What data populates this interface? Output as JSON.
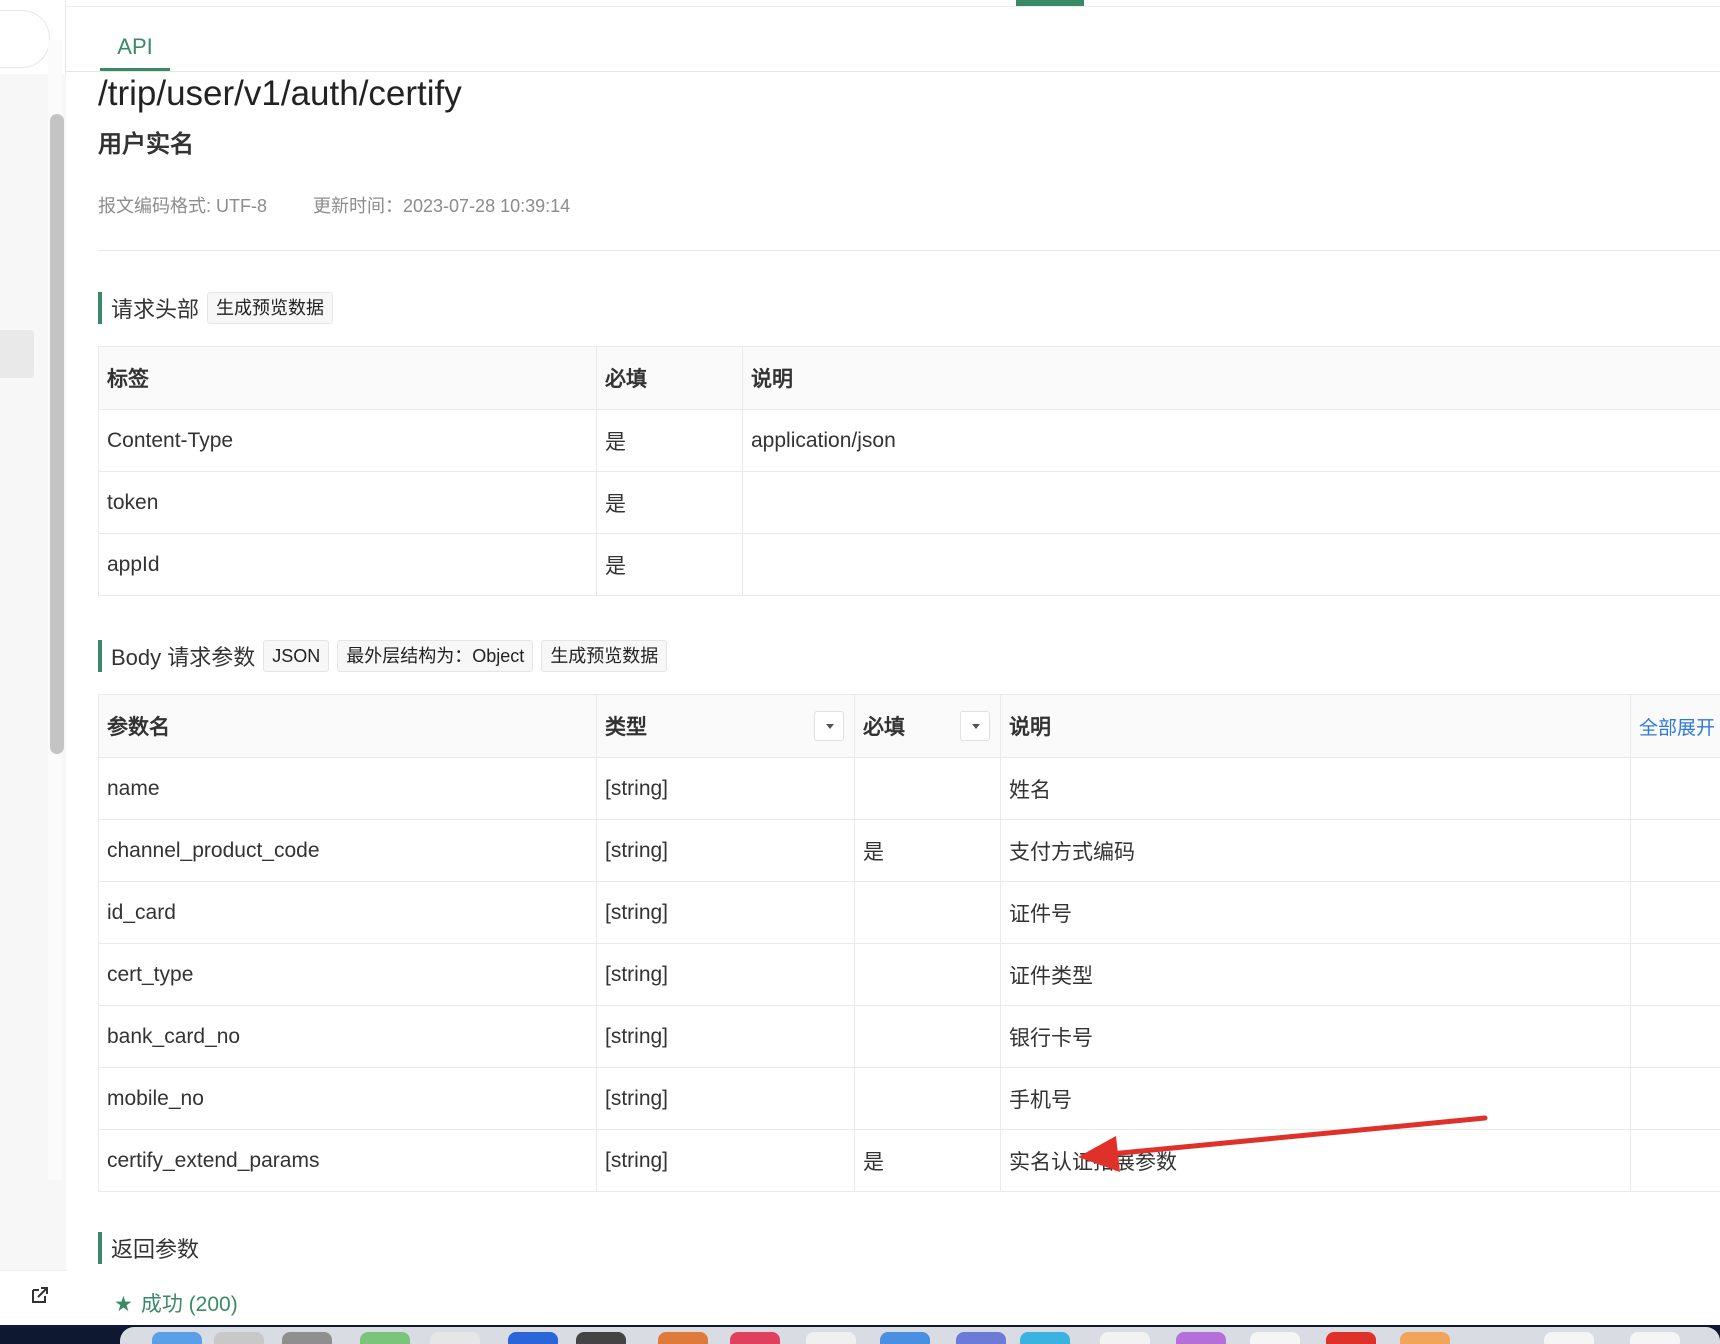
{
  "header": {
    "tab_label": "API"
  },
  "api": {
    "path": "/trip/user/v1/auth/certify",
    "name": "用户实名",
    "encoding": "报文编码格式: UTF-8",
    "updated": "更新时间：2023-07-28 10:39:14"
  },
  "request_headers": {
    "title": "请求头部",
    "preview_button": "生成预览数据",
    "columns": [
      "标签",
      "必填",
      "说明"
    ],
    "rows": [
      {
        "name": "Content-Type",
        "required": "是",
        "desc": "application/json"
      },
      {
        "name": "token",
        "required": "是",
        "desc": ""
      },
      {
        "name": "appId",
        "required": "是",
        "desc": ""
      }
    ]
  },
  "body_params": {
    "title": "Body 请求参数",
    "format_tag": "JSON",
    "structure_tag": "最外层结构为：Object",
    "preview_button": "生成预览数据",
    "columns": [
      "参数名",
      "类型",
      "必填",
      "说明"
    ],
    "expand_all": "全部展开",
    "rows": [
      {
        "name": "name",
        "type": "[string]",
        "required": "",
        "desc": "姓名"
      },
      {
        "name": "channel_product_code",
        "type": "[string]",
        "required": "是",
        "desc": "支付方式编码"
      },
      {
        "name": "id_card",
        "type": "[string]",
        "required": "",
        "desc": "证件号"
      },
      {
        "name": "cert_type",
        "type": "[string]",
        "required": "",
        "desc": "证件类型"
      },
      {
        "name": "bank_card_no",
        "type": "[string]",
        "required": "",
        "desc": "银行卡号"
      },
      {
        "name": "mobile_no",
        "type": "[string]",
        "required": "",
        "desc": "手机号"
      },
      {
        "name": "certify_extend_params",
        "type": "[string]",
        "required": "是",
        "desc": "实名认证拓展参数"
      }
    ]
  },
  "response": {
    "title": "返回参数",
    "success_label": "成功 (200)"
  },
  "icons": {
    "export": "external-link-icon",
    "filter": "caret-down-icon",
    "success": "star-icon"
  },
  "colors": {
    "accent": "#3b8a67",
    "link": "#2f7ad8",
    "annotation": "#e0302a"
  }
}
